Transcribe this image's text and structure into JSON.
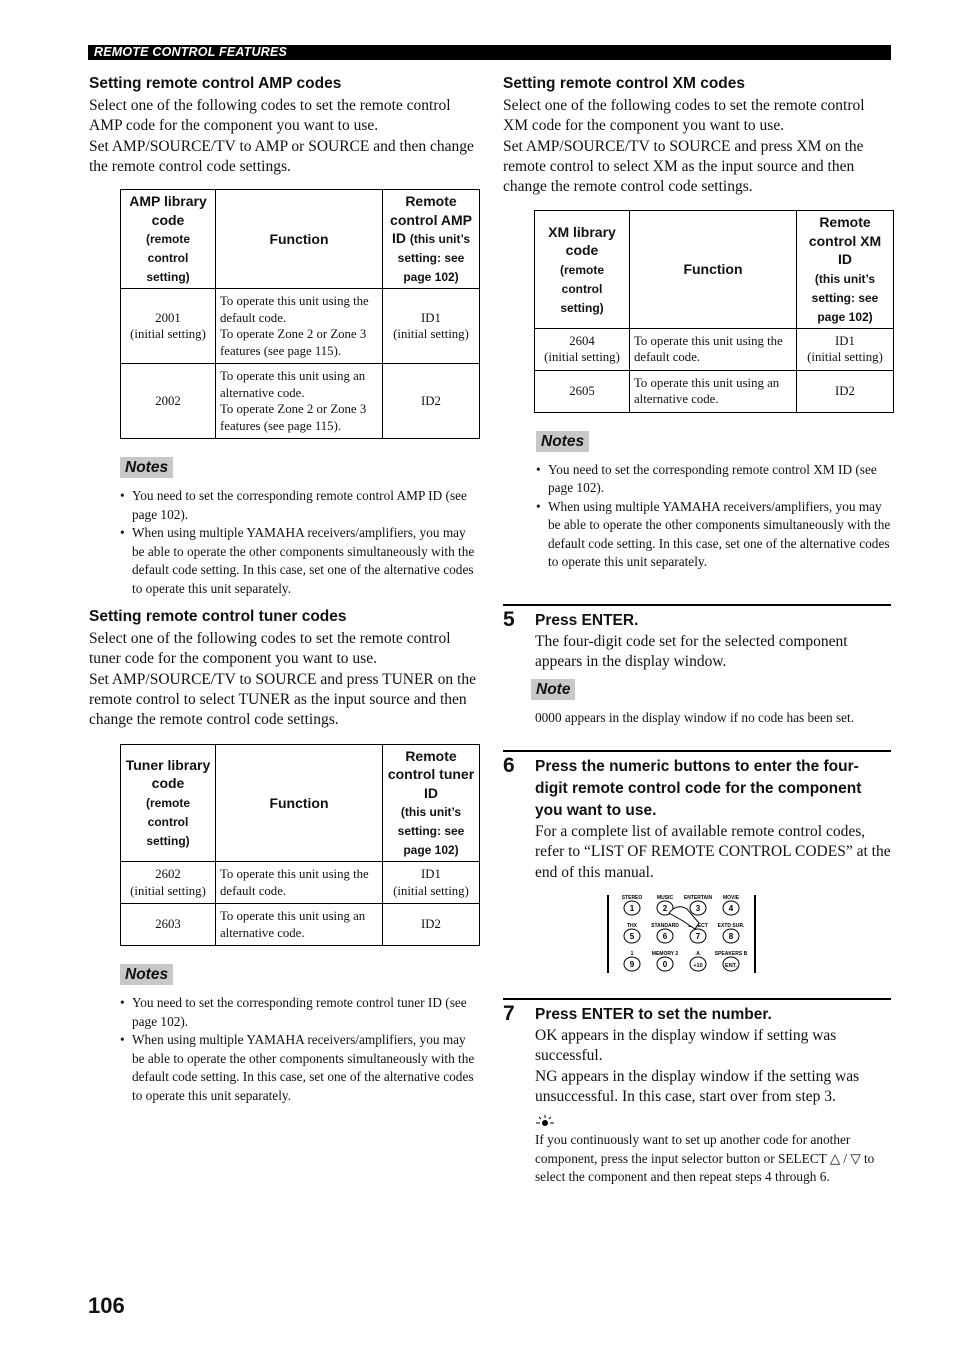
{
  "header": {
    "section_title": "REMOTE CONTROL FEATURES"
  },
  "amp": {
    "heading": "Setting remote control AMP codes",
    "intro": [
      "Select one of the following codes to set the remote control AMP code for the component you want to use.",
      "Set AMP/SOURCE/TV to AMP or SOURCE and then change the remote control code settings."
    ],
    "table": {
      "headers": [
        {
          "main": "AMP library code",
          "sub": "(remote control setting)"
        },
        {
          "main": "Function",
          "sub": ""
        },
        {
          "main": "Remote control AMP ID",
          "sub": "(this unit’s setting: see page 102)"
        }
      ],
      "rows": [
        {
          "code": "2001",
          "code_note": "(initial setting)",
          "function": [
            "To operate this unit using the default code.",
            "To operate Zone 2 or Zone 3 features (see page 115)."
          ],
          "id": "ID1",
          "id_note": "(initial setting)"
        },
        {
          "code": "2002",
          "code_note": "",
          "function": [
            "To operate this unit using an alternative code.",
            "To operate Zone 2 or Zone 3 features (see page 115)."
          ],
          "id": "ID2",
          "id_note": ""
        }
      ]
    },
    "notes_label": "Notes",
    "notes": [
      "You need to set the corresponding remote control AMP ID (see page 102).",
      "When using multiple YAMAHA receivers/amplifiers, you may be able to operate the other components simultaneously with the default code setting. In this case, set one of the alternative codes to operate this unit separately."
    ]
  },
  "tuner": {
    "heading": "Setting remote control tuner codes",
    "intro": [
      "Select one of the following codes to set the remote control tuner code for the component you want to use.",
      "Set AMP/SOURCE/TV to SOURCE and press TUNER on the remote control to select TUNER as the input source and then change the remote control code settings."
    ],
    "table": {
      "headers": [
        {
          "main": "Tuner library code",
          "sub": "(remote control setting)"
        },
        {
          "main": "Function",
          "sub": ""
        },
        {
          "main": "Remote control tuner ID",
          "sub": "(this unit’s setting: see page 102)"
        }
      ],
      "rows": [
        {
          "code": "2602",
          "code_note": "(initial setting)",
          "function": [
            "To operate this unit using the default code."
          ],
          "id": "ID1",
          "id_note": "(initial setting)"
        },
        {
          "code": "2603",
          "code_note": "",
          "function": [
            "To operate this unit using an alternative code."
          ],
          "id": "ID2",
          "id_note": ""
        }
      ]
    },
    "notes_label": "Notes",
    "notes": [
      "You need to set the corresponding remote control tuner ID (see page 102).",
      "When using multiple YAMAHA receivers/amplifiers, you may be able to operate the other components simultaneously with the default code setting. In this case, set one of the alternative codes to operate this unit separately."
    ]
  },
  "xm": {
    "heading": "Setting remote control XM codes",
    "intro": [
      "Select one of the following codes to set the remote control XM code for the component you want to use.",
      "Set AMP/SOURCE/TV to SOURCE and press XM on the remote control to select XM as the input source and then change the remote control code settings."
    ],
    "table": {
      "headers": [
        {
          "main": "XM library code",
          "sub": "(remote control setting)"
        },
        {
          "main": "Function",
          "sub": ""
        },
        {
          "main": "Remote control XM ID",
          "sub": "(this unit’s setting: see page 102)"
        }
      ],
      "rows": [
        {
          "code": "2604",
          "code_note": "(initial setting)",
          "function": [
            "To operate this unit using the default code."
          ],
          "id": "ID1",
          "id_note": "(initial setting)"
        },
        {
          "code": "2605",
          "code_note": "",
          "function": [
            "To operate this unit using an alternative code."
          ],
          "id": "ID2",
          "id_note": ""
        }
      ]
    },
    "notes_label": "Notes",
    "notes": [
      "You need to set the corresponding remote control XM ID (see page 102).",
      "When using multiple YAMAHA receivers/amplifiers, you may be able to operate the other components simultaneously with the default code setting. In this case, set one of the alternative codes to operate this unit separately."
    ]
  },
  "steps": [
    {
      "number": "5",
      "title": "Press ENTER.",
      "body": [
        "The four-digit code set for the selected component appears in the display window."
      ],
      "note_label": "Note",
      "note": "0000 appears in the display window if no code has been set."
    },
    {
      "number": "6",
      "title": "Press the numeric buttons to enter the four-digit remote control code for the component you want to use.",
      "body": [
        "For a complete list of available remote control codes, refer to “LIST OF REMOTE CONTROL CODES” at the end of this manual."
      ]
    },
    {
      "number": "7",
      "title": "Press ENTER to set the number.",
      "body": [
        "OK appears in the display window if setting was successful.",
        "NG appears in the display window if the setting was unsuccessful. In this case, start over from step 3."
      ],
      "tip_icon": "lightbulb-tip-icon",
      "tip": "If you continuously want to set up another code for another component, press the input selector button or SELECT △ / ▽ to select the component and then repeat steps 4 through 6."
    }
  ],
  "remote_illustration": {
    "buttons": [
      {
        "label": "STEREO",
        "key": "1"
      },
      {
        "label": "MUSIC",
        "key": "2"
      },
      {
        "label": "ENTERTAIN",
        "key": "3"
      },
      {
        "label": "MOVIE",
        "key": "4"
      },
      {
        "label": "THX",
        "key": "5"
      },
      {
        "label": "STANDARD",
        "key": "6"
      },
      {
        "label": "SELECT",
        "key": "7"
      },
      {
        "label": "EXTD SUR.",
        "key": "8"
      },
      {
        "label": "1",
        "key": "9"
      },
      {
        "label": "MEMORY 2",
        "key": "0"
      },
      {
        "label": "A",
        "key": "+10"
      },
      {
        "label": "SPEAKERS B",
        "key": "ENT."
      }
    ]
  },
  "page_number": "106"
}
